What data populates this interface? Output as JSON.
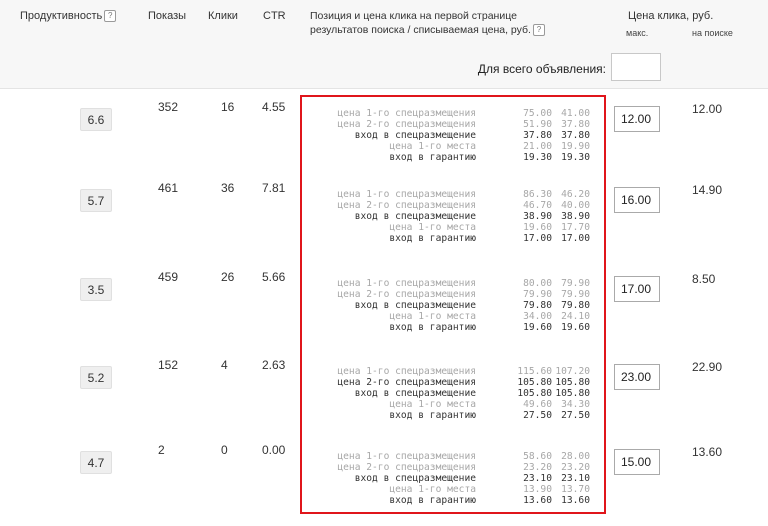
{
  "header": {
    "productivity": "Продуктивность",
    "help": "?",
    "shows": "Показы",
    "clicks": "Клики",
    "ctr": "CTR",
    "position_line1": "Позиция и цена клика на первой странице",
    "position_line2": "результатов поиска / списываемая цена, руб.",
    "bid_title": "Цена клика, руб.",
    "bid_max": "макс.",
    "bid_search": "на поиске"
  },
  "whole_ad_label": "Для всего объявления:",
  "auction_labels": [
    "цена 1-го спецразмещения",
    "цена 2-го спецразмещения",
    "вход в спецразмещение",
    "цена 1-го места",
    "вход в гарантию"
  ],
  "rows": [
    {
      "productivity": "6.6",
      "shows": "352",
      "clicks": "16",
      "ctr": "4.55",
      "bid": "12.00",
      "search_price": "12.00",
      "auction": [
        {
          "v1": "75.00",
          "v2": "41.00"
        },
        {
          "v1": "51.90",
          "v2": "37.80"
        },
        {
          "v1": "37.80",
          "v2": "37.80"
        },
        {
          "v1": "21.00",
          "v2": "19.90"
        },
        {
          "v1": "19.30",
          "v2": "19.30"
        }
      ]
    },
    {
      "productivity": "5.7",
      "shows": "461",
      "clicks": "36",
      "ctr": "7.81",
      "bid": "16.00",
      "search_price": "14.90",
      "auction": [
        {
          "v1": "86.30",
          "v2": "46.20"
        },
        {
          "v1": "46.70",
          "v2": "40.00"
        },
        {
          "v1": "38.90",
          "v2": "38.90"
        },
        {
          "v1": "19.60",
          "v2": "17.70"
        },
        {
          "v1": "17.00",
          "v2": "17.00"
        }
      ]
    },
    {
      "productivity": "3.5",
      "shows": "459",
      "clicks": "26",
      "ctr": "5.66",
      "bid": "17.00",
      "search_price": "8.50",
      "auction": [
        {
          "v1": "80.00",
          "v2": "79.90"
        },
        {
          "v1": "79.90",
          "v2": "79.90"
        },
        {
          "v1": "79.80",
          "v2": "79.80"
        },
        {
          "v1": "34.00",
          "v2": "24.10"
        },
        {
          "v1": "19.60",
          "v2": "19.60"
        }
      ]
    },
    {
      "productivity": "5.2",
      "shows": "152",
      "clicks": "4",
      "ctr": "2.63",
      "bid": "23.00",
      "search_price": "22.90",
      "auction": [
        {
          "v1": "115.60",
          "v2": "107.20"
        },
        {
          "v1": "105.80",
          "v2": "105.80"
        },
        {
          "v1": "105.80",
          "v2": "105.80"
        },
        {
          "v1": "49.60",
          "v2": "34.30"
        },
        {
          "v1": "27.50",
          "v2": "27.50"
        }
      ]
    },
    {
      "productivity": "4.7",
      "shows": "2",
      "clicks": "0",
      "ctr": "0.00",
      "bid": "15.00",
      "search_price": "13.60",
      "auction": [
        {
          "v1": "58.60",
          "v2": "28.00"
        },
        {
          "v1": "23.20",
          "v2": "23.20"
        },
        {
          "v1": "23.10",
          "v2": "23.10"
        },
        {
          "v1": "13.90",
          "v2": "13.70"
        },
        {
          "v1": "13.60",
          "v2": "13.60"
        }
      ]
    }
  ],
  "colors": {
    "highlight_border": "#e0151b",
    "muted_text": "#a7a7a7",
    "header_bg": "#f7f7f7"
  }
}
